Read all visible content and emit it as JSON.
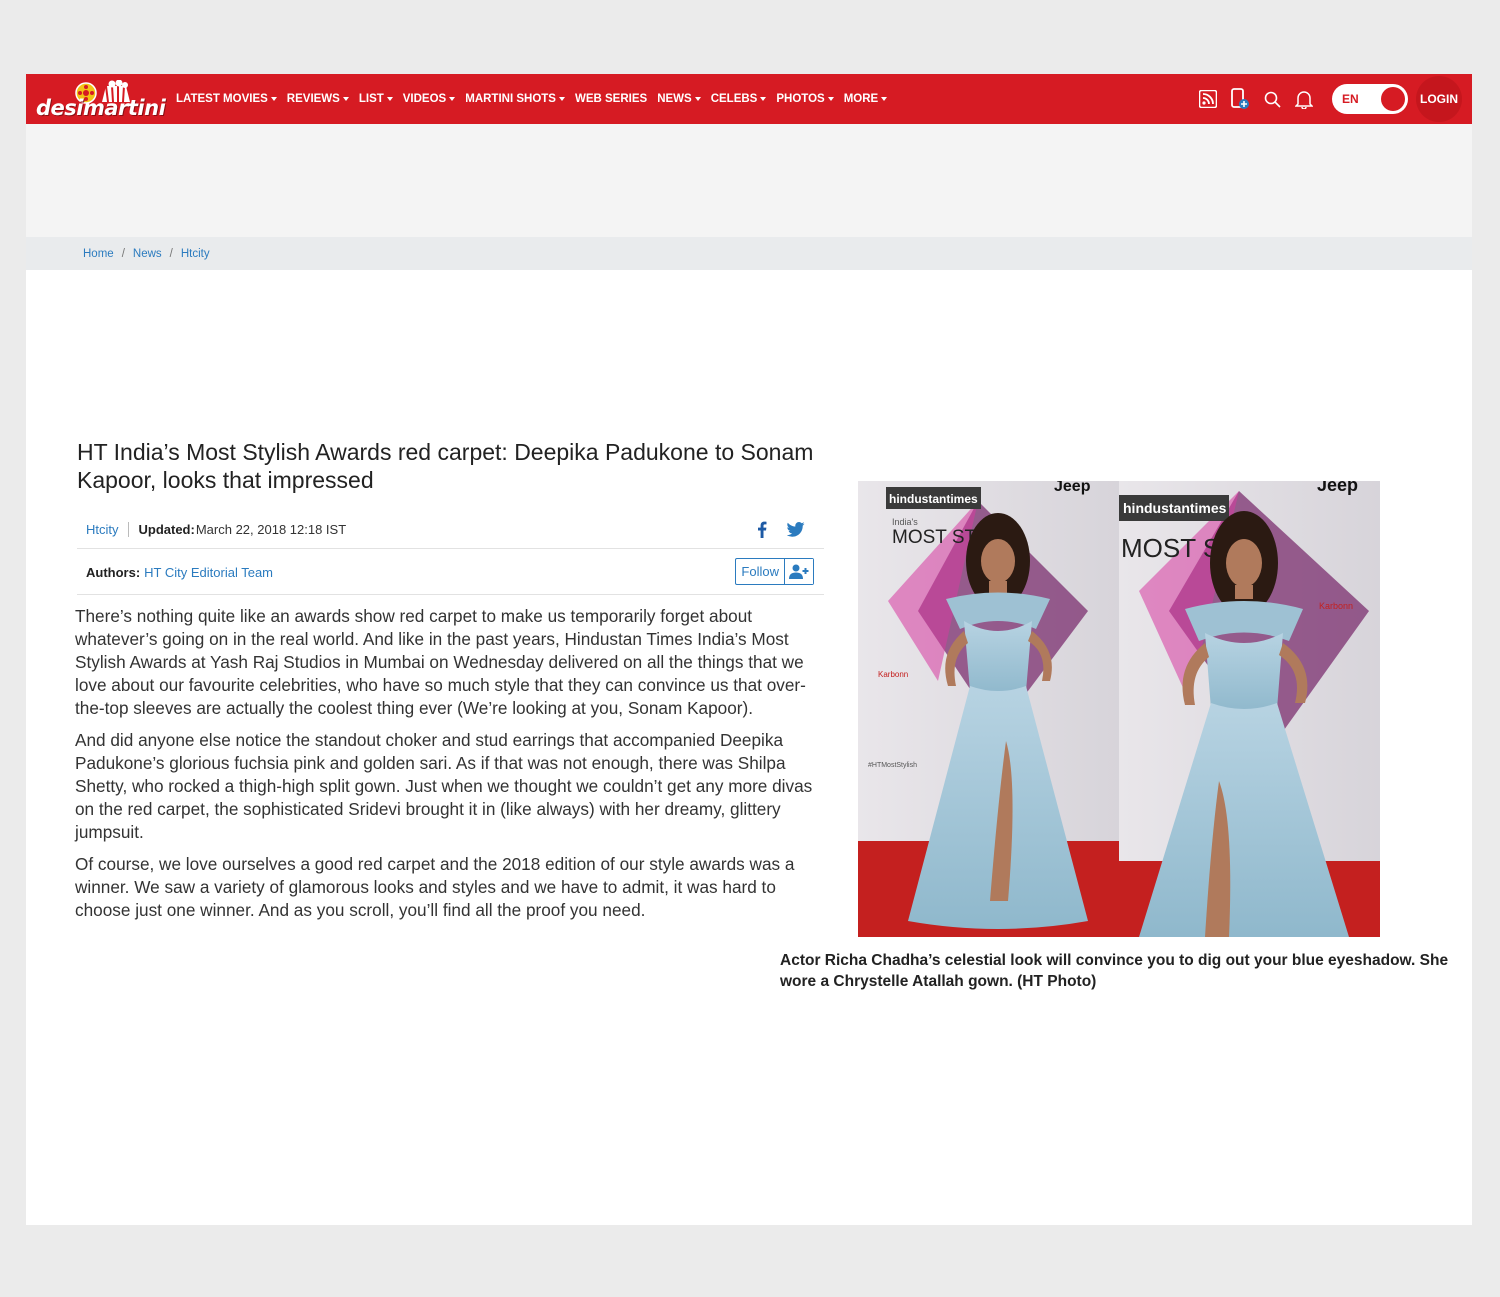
{
  "header": {
    "logo_text": "desimartini",
    "nav": [
      {
        "label": "LATEST MOVIES",
        "has_menu": true
      },
      {
        "label": "REVIEWS",
        "has_menu": true
      },
      {
        "label": "LIST",
        "has_menu": true
      },
      {
        "label": "VIDEOS",
        "has_menu": true
      },
      {
        "label": "MARTINI SHOTS",
        "has_menu": true
      },
      {
        "label": "WEB SERIES",
        "has_menu": false
      },
      {
        "label": "NEWS",
        "has_menu": true
      },
      {
        "label": "CELEBS",
        "has_menu": true
      },
      {
        "label": "PHOTOS",
        "has_menu": true
      },
      {
        "label": "MORE",
        "has_menu": true
      }
    ],
    "icons": [
      "rss-icon",
      "mobile-app-icon",
      "search-icon",
      "bell-icon"
    ],
    "language": "EN",
    "login_label": "LOGIN"
  },
  "breadcrumb": [
    "Home",
    "News",
    "Htcity"
  ],
  "article": {
    "headline": "HT India’s Most Stylish Awards red carpet: Deepika Padukone to Sonam Kapoor, looks that impressed",
    "category": "Htcity",
    "updated_label": "Updated:",
    "updated_value": "March 22, 2018 12:18 IST",
    "authors_label": "Authors:",
    "author": "HT City Editorial Team",
    "follow_label": "Follow",
    "paragraphs": [
      "There’s nothing quite like an awards show red carpet to make us temporarily forget about whatever’s going on in the real world. And like in the past years, Hindustan Times India’s Most Stylish Awards at Yash Raj Studios in Mumbai on Wednesday delivered on all the things that we love about our favourite celebrities, who have so much style that they can convince us that over-the-top sleeves are actually the coolest thing ever (We’re looking at you, Sonam Kapoor).",
      "And did anyone else notice the standout choker and stud earrings that accompanied Deepika Padukone’s glorious fuchsia pink and golden sari. As if that was not enough, there was Shilpa Shetty, who rocked a thigh-high split gown. Just when we thought we couldn’t get any more divas on the red carpet, the sophisticated Sridevi brought it in (like always) with her dreamy, glittery jumpsuit.",
      "Of course, we love ourselves a good red carpet and the 2018 edition of our style awards was a winner. We saw a variety of glamorous looks and styles and we have to admit, it was hard to choose just one winner. And as you scroll, you’ll find all the proof you need."
    ],
    "photo": {
      "backdrop_text": [
        "hindustantimes",
        "India's",
        "MOST STYLI",
        "Jeep",
        "Karbonn",
        "#HTMostStylish"
      ],
      "caption": "Actor Richa Chadha’s celestial look will convince you to dig out your blue eyeshadow. She wore a Chrystelle Atallah gown. (HT Photo)"
    }
  },
  "colors": {
    "brand": "#d61b23",
    "link": "#2b7bbf",
    "gown": "#9cc3d6",
    "carpet": "#c4201f"
  }
}
